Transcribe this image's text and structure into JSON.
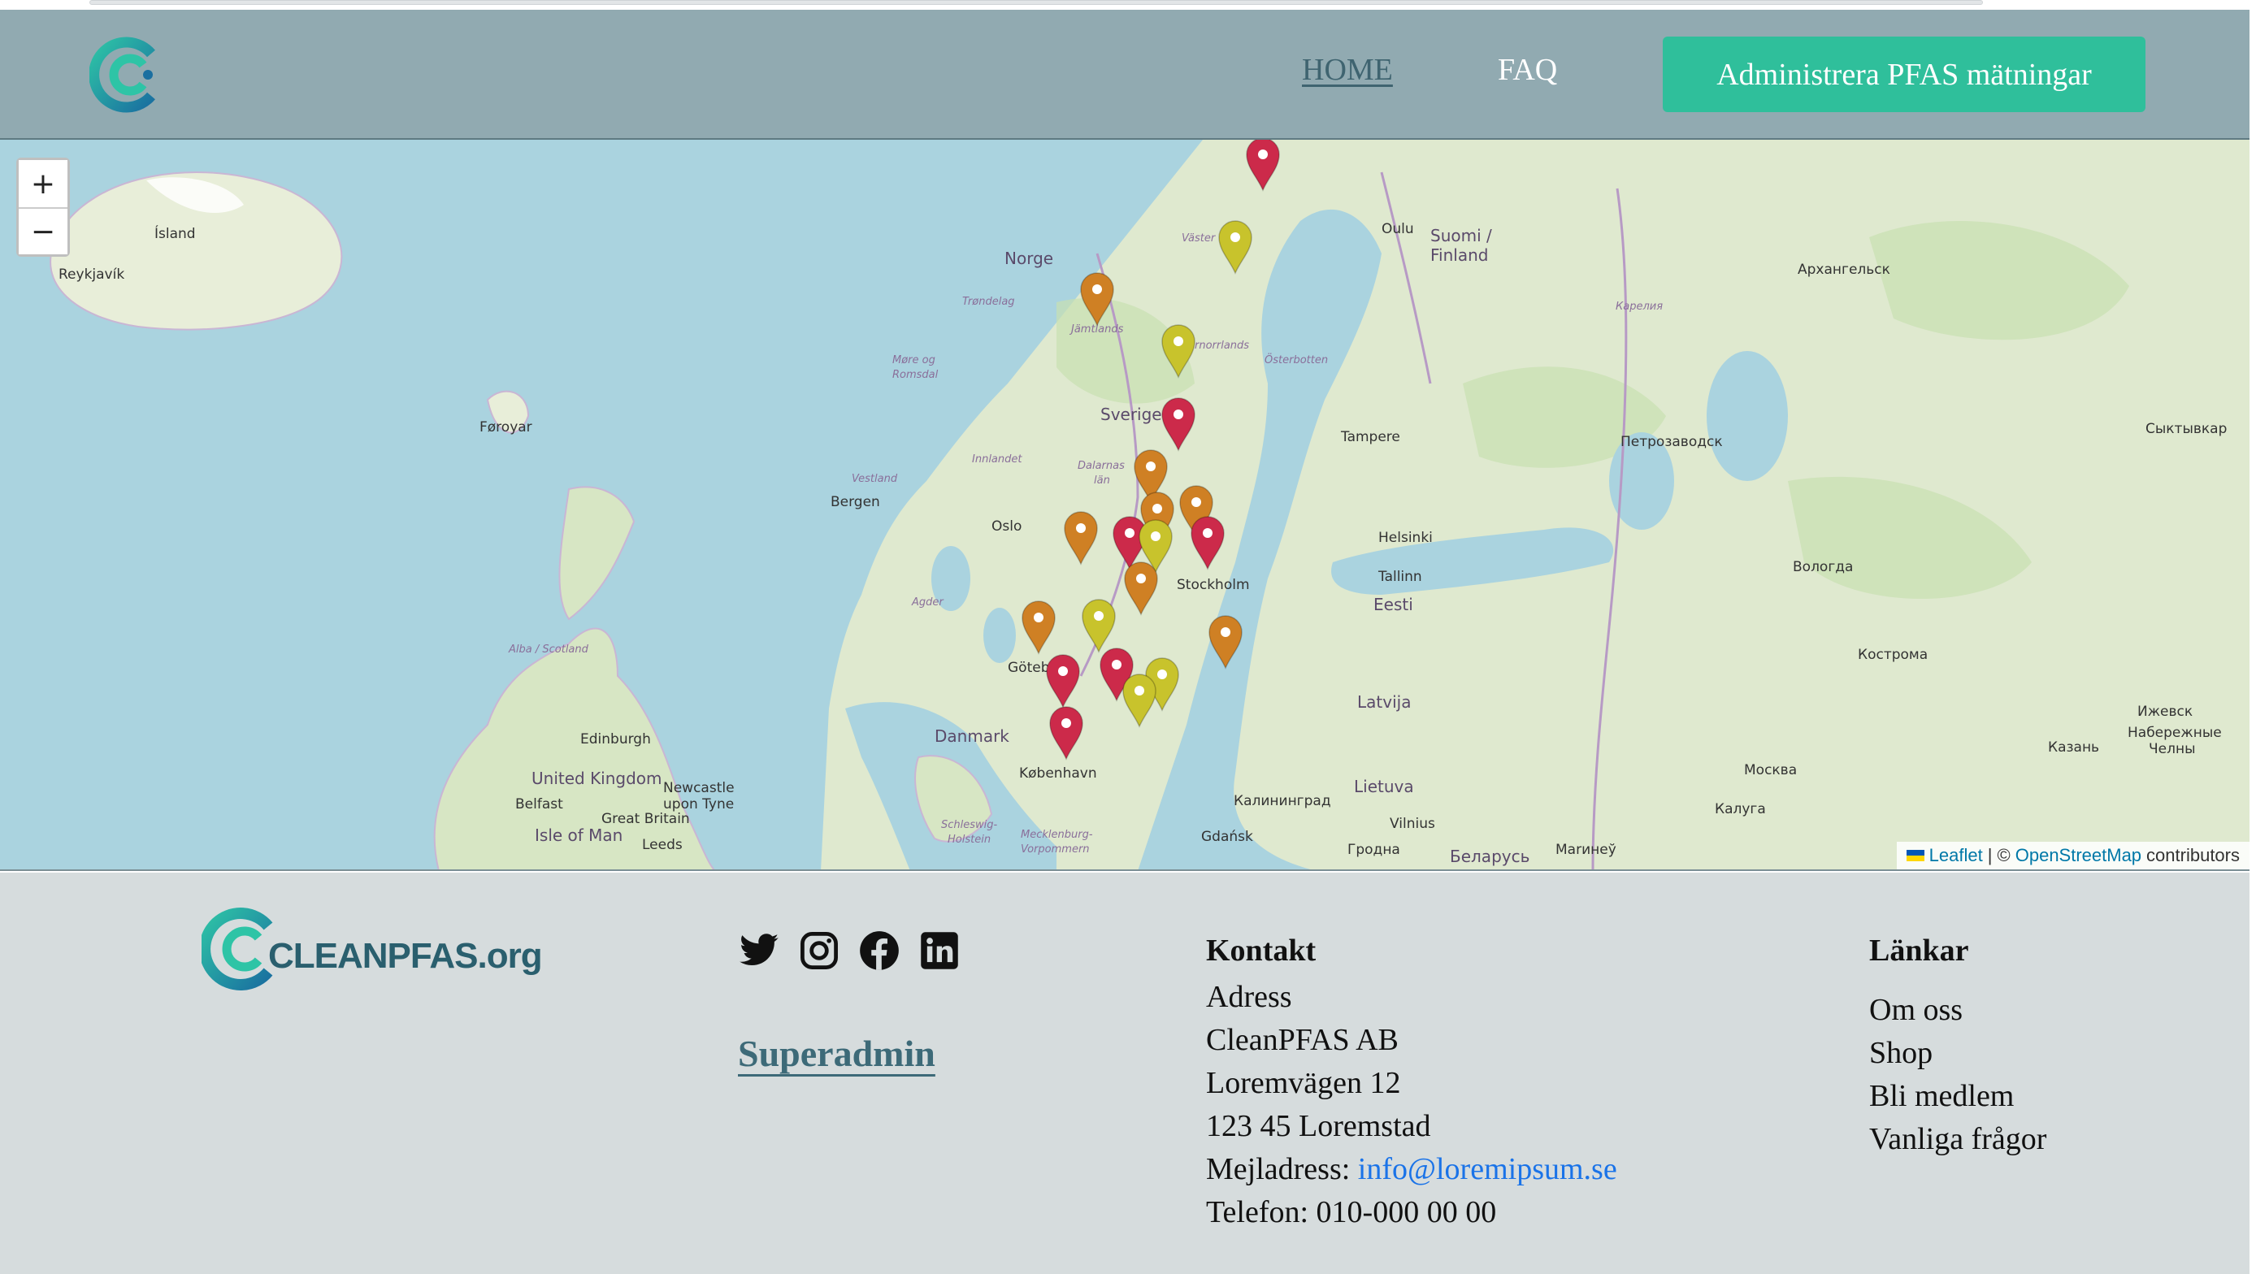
{
  "header": {
    "nav": {
      "home": "HOME",
      "faq": "FAQ"
    },
    "admin_button": "Administrera PFAS mätningar"
  },
  "map": {
    "zoom_in": "+",
    "zoom_out": "−",
    "attribution": {
      "leaflet": "Leaflet",
      "sep": "| ©",
      "osm": "OpenStreetMap",
      "suffix": "contributors"
    },
    "labels": {
      "island": "Ísland",
      "reykjavik": "Reykjavík",
      "norge": "Norge",
      "sverige": "Sverige",
      "suomi": "Suomi /",
      "finland": "Finland",
      "foroyar": "Føroyar",
      "bergen": "Bergen",
      "oslo": "Oslo",
      "stockholm": "Stockholm",
      "helsinki": "Helsinki",
      "tallinn": "Tallinn",
      "eesti": "Eesti",
      "latvija": "Latvija",
      "lietuva": "Lietuva",
      "danmark": "Danmark",
      "kobenhavn": "København",
      "goteborg": "Göteb",
      "uk": "United Kingdom",
      "edinburgh": "Edinburgh",
      "newcastle": "Newcastle",
      "upontyne": "upon Tyne",
      "belfast": "Belfast",
      "greatbritain": "Great Britain",
      "isleofman": "Isle of Man",
      "leeds": "Leeds",
      "oulu": "Oulu",
      "tampere": "Tampere",
      "arkhangelsk": "Архангельск",
      "petrozavodsk": "Петрозаводск",
      "syktyvkar": "Сыктывкар",
      "vologda": "Вологда",
      "kostroma": "Кострома",
      "moskva": "Москва",
      "kaluga": "Калуга",
      "kazan": "Казань",
      "izhevsk": "Ижевск",
      "naberezhnye": "Набережные",
      "chelny": "Челны",
      "kaliningrad": "Калининград",
      "gdansk": "Gdańsk",
      "vilnius": "Vilnius",
      "grodna": "Гродна",
      "belarus": "Беларусь",
      "mariupol": "Marинeў",
      "trondelag": "Trøndelag",
      "innlandet": "Innlandet",
      "vestland": "Vestland",
      "agder": "Agder",
      "dalarnas": "Dalarnas",
      "lan": "län",
      "jamtlands": "Jämtlands",
      "vasternorrlands": "rnorrlands",
      "vaster": "Väster",
      "ostrobotten": "Österbotten",
      "karelia": "Карелия",
      "alba": "Alba / Scotland",
      "schleswig": "Schleswig-",
      "holstein": "Holstein",
      "mecklenburg": "Mecklenburg-",
      "vorpommern": "Vorpommern",
      "moreog": "Møre og",
      "romsdal": "Romsdal"
    }
  },
  "footer": {
    "brand_logo_text": "CLEANPFAS.org",
    "superadmin": "Superadmin",
    "contact": {
      "heading": "Kontakt",
      "address_label": "Adress",
      "company": "CleanPFAS AB",
      "street": "Loremvägen 12",
      "postal": "123 45 Loremstad",
      "email_label": "Mejladress:",
      "email": "info@loremipsum.se",
      "phone": "Telefon: 010-000 00 00"
    },
    "links": {
      "heading": "Länkar",
      "items": [
        "Om oss",
        "Shop",
        "Bli medlem",
        "Vanliga frågor"
      ]
    }
  },
  "icons": {
    "social": [
      "twitter-icon",
      "instagram-icon",
      "facebook-icon",
      "linkedin-icon"
    ],
    "markers": {
      "red": "#cc2a4a",
      "orange": "#cf8024",
      "yellow": "#c8c32c"
    }
  },
  "colors": {
    "header": "#91aab1",
    "accent": "#2fbf9b",
    "footer": "#d6dcdd",
    "sea": "#aad3df",
    "land": "#e9efe0"
  }
}
